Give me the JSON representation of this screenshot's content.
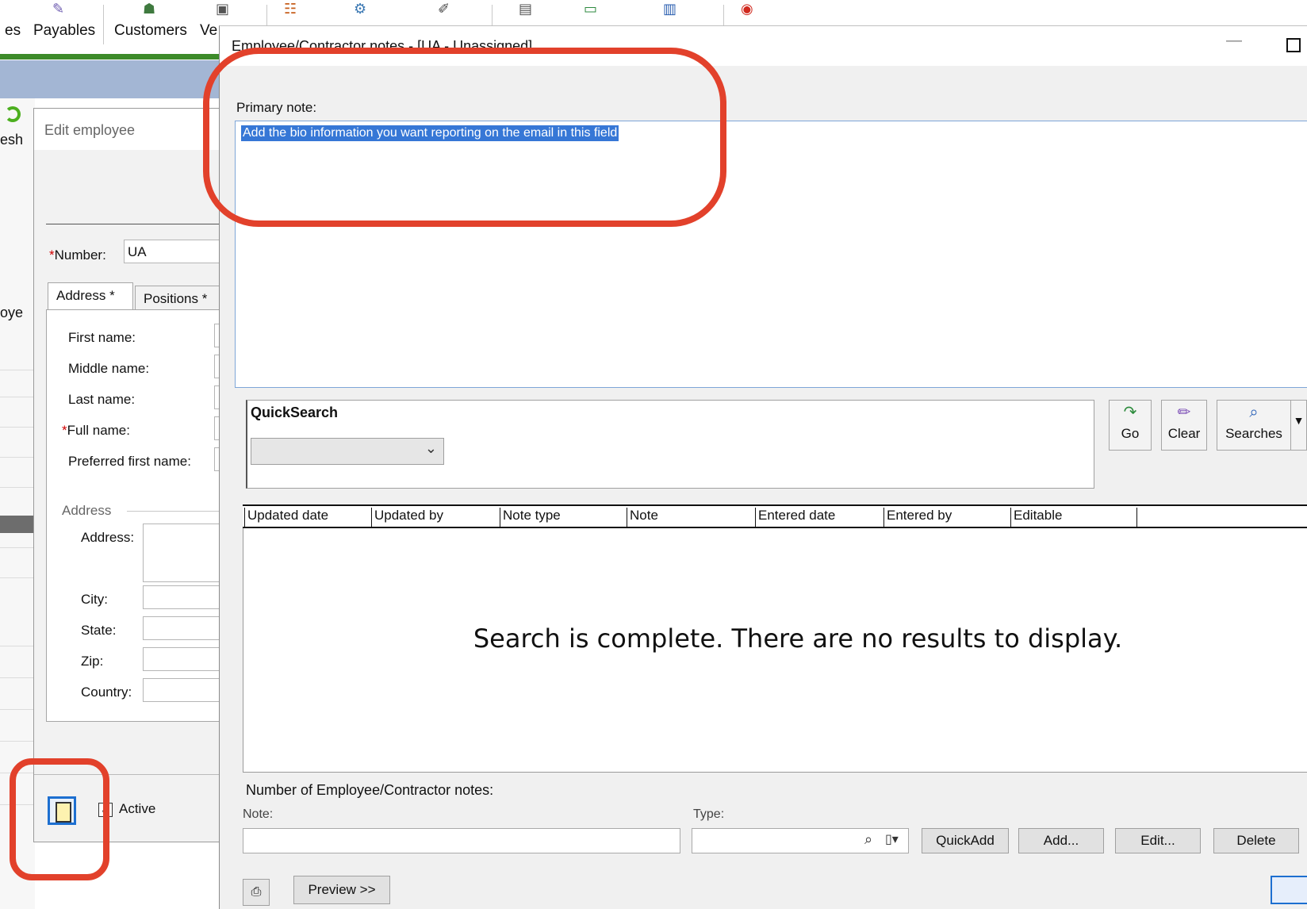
{
  "toolbar": {
    "items": [
      {
        "label": "es"
      },
      {
        "label": "Payables"
      },
      {
        "label": "Customers"
      },
      {
        "label": "Ve"
      }
    ]
  },
  "left_fragments": {
    "refresh": "esh",
    "employee": "oye"
  },
  "edit_employee": {
    "title": "Edit employee",
    "number_label": "Number:",
    "number_required": "*",
    "number_value": "UA",
    "tabs": [
      {
        "label": "Address *"
      },
      {
        "label": "Positions *"
      }
    ],
    "fields": {
      "first_name": "First name:",
      "middle_name": "Middle name:",
      "last_name": "Last name:",
      "full_name": "Full name:",
      "full_name_required": "*",
      "preferred_first_name": "Preferred first name:"
    },
    "address_group": "Address",
    "address_fields": {
      "address": "Address:",
      "city": "City:",
      "state": "State:",
      "zip": "Zip:",
      "country": "Country:"
    },
    "active_label": "Active"
  },
  "notes_window": {
    "title": "Employee/Contractor notes - [UA - Unassigned]",
    "primary_note_label": "Primary note:",
    "primary_note_value": "Add the bio information you want reporting on the email in this field",
    "quicksearch": {
      "title": "QuickSearch"
    },
    "action_buttons": [
      {
        "label": "Go",
        "icon": "redo-arrow-icon"
      },
      {
        "label": "Clear",
        "icon": "eraser-icon"
      },
      {
        "label": "Searches",
        "icon": "magnifier-icon"
      }
    ],
    "columns": [
      "Updated date",
      "Updated by",
      "Note type",
      "Note",
      "Entered date",
      "Entered by",
      "Editable"
    ],
    "empty_message": "Search is complete. There are no results to display.",
    "count_label": "Number of Employee/Contractor notes:",
    "note_label": "Note:",
    "type_label": "Type:",
    "buttons": {
      "quickadd": "QuickAdd",
      "add": "Add...",
      "edit": "Edit...",
      "delete": "Delete",
      "preview": "Preview >>"
    }
  },
  "colors": {
    "annotation": "#e2412b",
    "selection": "#3677d6",
    "toolbar_green": "#3d8b2a",
    "header_blue": "#a3b6d4"
  }
}
